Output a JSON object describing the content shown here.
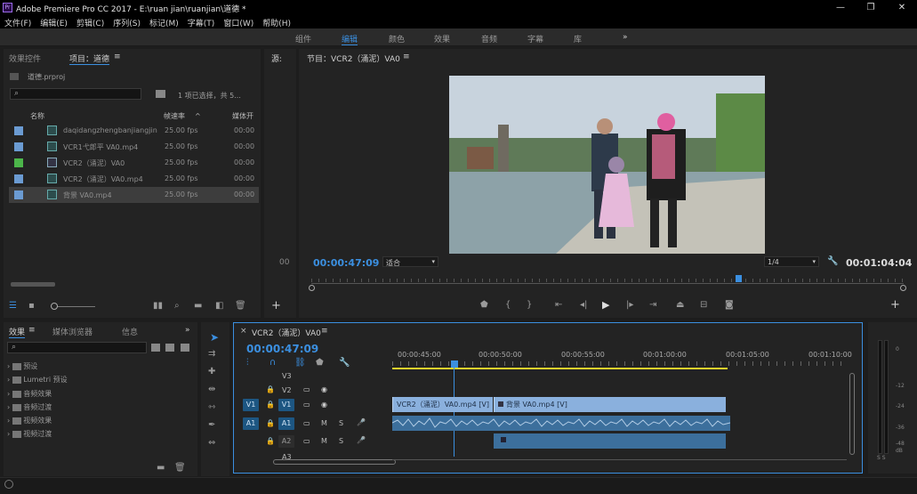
{
  "app": {
    "title": "Adobe Premiere Pro CC 2017 - E:\\ruan jian\\ruanjian\\道德 *",
    "window_controls": [
      "—",
      "❐",
      "✕"
    ]
  },
  "menu": [
    "文件(F)",
    "编辑(E)",
    "剪辑(C)",
    "序列(S)",
    "标记(M)",
    "字幕(T)",
    "窗口(W)",
    "帮助(H)"
  ],
  "workspaces": {
    "items": [
      "组件",
      "编辑",
      "颜色",
      "效果",
      "音频",
      "字幕",
      "库"
    ],
    "active": "编辑",
    "more": "»"
  },
  "project_panel": {
    "tabs": [
      "效果控件",
      "项目：道德"
    ],
    "menu_glyph": "≡",
    "project_file": "道德.prproj",
    "search_placeholder": "",
    "selection_info": "1 项已选择，共 5...",
    "columns": [
      "名称",
      "帧速率",
      "媒体开"
    ],
    "sort_glyph": "^",
    "items": [
      {
        "name": "daqidangzhengbanjiangjin",
        "fps": "25.00 fps",
        "start": "00:00",
        "color": "#6b9bd2",
        "selected": false
      },
      {
        "name": "VCR1弋郎平 VA0.mp4",
        "fps": "25.00 fps",
        "start": "00:00",
        "color": "#6b9bd2",
        "selected": false
      },
      {
        "name": "VCR2（涌泥）VA0",
        "fps": "25.00 fps",
        "start": "00:00",
        "color": "#4cb54a",
        "selected": false
      },
      {
        "name": "VCR2（涌泥）VA0.mp4",
        "fps": "25.00 fps",
        "start": "00:00",
        "color": "#6b9bd2",
        "selected": false
      },
      {
        "name": "背景 VA0.mp4",
        "fps": "25.00 fps",
        "start": "00:00",
        "color": "#6b9bd2",
        "selected": true
      }
    ]
  },
  "source_panel": {
    "label": "源:",
    "partial_timecode": "00"
  },
  "program_panel": {
    "tab": "节目：VCR2（涌泥）VA0",
    "menu_glyph": "≡",
    "current_timecode": "00:00:47:09",
    "fit": "适合",
    "resolution": "1/4",
    "duration": "00:01:04:04",
    "playhead_fraction": 0.72
  },
  "effects_panel": {
    "tabs": [
      "效果",
      "媒体浏览器",
      "信息"
    ],
    "menu_glyph": "≡",
    "more": "»",
    "tree": [
      "预设",
      "Lumetri 预设",
      "音频效果",
      "音频过渡",
      "视频效果",
      "视频过渡"
    ]
  },
  "tools": [
    "selection",
    "track-select",
    "ripple",
    "razor",
    "slip",
    "pen",
    "hand"
  ],
  "timeline": {
    "sequence_tab": "VCR2（涌泥）VA0",
    "close_glyph": "×",
    "menu_glyph": "≡",
    "timecode": "00:00:47:09",
    "ruler": [
      "00:00:45:00",
      "00:00:50:00",
      "00:00:55:00",
      "00:01:00:00",
      "00:01:05:00",
      "00:01:10:00"
    ],
    "tracks": {
      "video": [
        {
          "name": "V3",
          "target": ""
        },
        {
          "name": "V2",
          "target": ""
        },
        {
          "name": "V1",
          "target": "V1"
        }
      ],
      "audio": [
        {
          "name": "A1",
          "target": "A1"
        },
        {
          "name": "A2",
          "target": ""
        },
        {
          "name": "A3",
          "target": ""
        }
      ],
      "mute": "M",
      "solo": "S"
    },
    "clips": {
      "v1_a": "VCR2（涌泥）VA0.mp4 [V]",
      "v1_b": "背景 VA0.mp4 [V]"
    }
  },
  "vu_meter": {
    "ticks": [
      "0",
      "-12",
      "-24",
      "-36",
      "-48",
      "dB"
    ],
    "solo": "S S"
  },
  "colors": {
    "accent": "#3b8fe0",
    "panel_bg": "#232323",
    "video_clip": "#8ab0dd",
    "audio_clip": "#3c6f9c",
    "work_area": "#e5d22c"
  }
}
